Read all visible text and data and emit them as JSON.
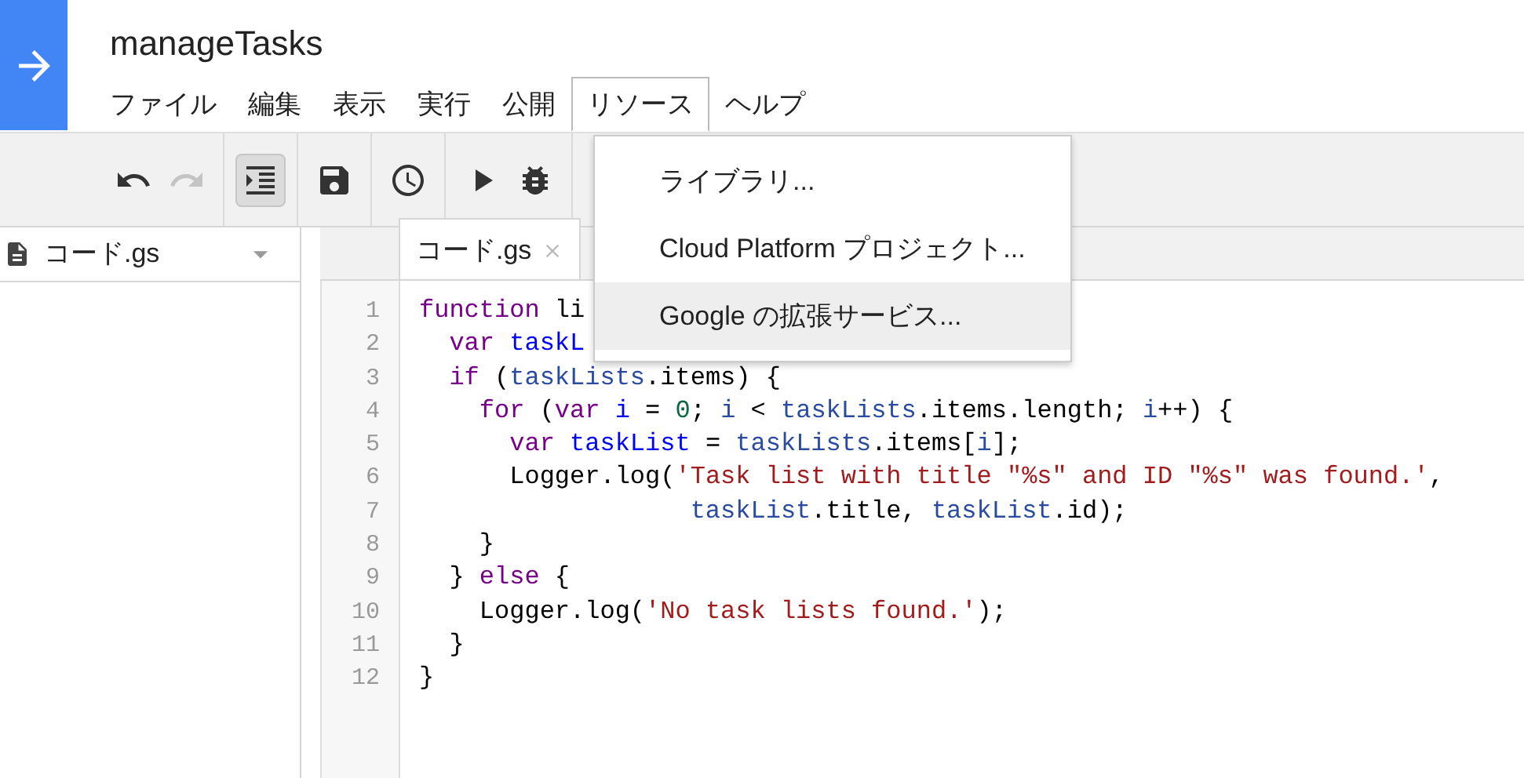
{
  "project": {
    "title": "manageTasks"
  },
  "menu": [
    {
      "label": "ファイル",
      "selected": false
    },
    {
      "label": "編集",
      "selected": false
    },
    {
      "label": "表示",
      "selected": false
    },
    {
      "label": "実行",
      "selected": false
    },
    {
      "label": "公開",
      "selected": false
    },
    {
      "label": "リソース",
      "selected": true
    },
    {
      "label": "ヘルプ",
      "selected": false
    }
  ],
  "toolbar": [
    {
      "kind": "undo",
      "disabled": false,
      "pressed": false
    },
    {
      "kind": "redo",
      "disabled": true,
      "pressed": false
    },
    {
      "kind": "indent",
      "disabled": false,
      "pressed": true
    },
    {
      "kind": "save",
      "disabled": false,
      "pressed": false
    },
    {
      "kind": "trigger",
      "disabled": false,
      "pressed": false
    },
    {
      "kind": "run",
      "disabled": false,
      "pressed": false
    },
    {
      "kind": "debug",
      "disabled": false,
      "pressed": false
    }
  ],
  "files": [
    {
      "name": "コード.gs"
    }
  ],
  "tabs": [
    {
      "label": "コード.gs",
      "selected": true
    }
  ],
  "dropdown": [
    {
      "label": "ライブラリ...",
      "highlighted": false
    },
    {
      "label": "Cloud Platform プロジェクト...",
      "highlighted": false
    },
    {
      "label": "Google の拡張サービス...",
      "highlighted": true
    }
  ],
  "code": [
    [
      {
        "text": "function",
        "kind": "keyword"
      },
      {
        "text": " li",
        "kind": "plain"
      }
    ],
    [
      {
        "text": "  var",
        "kind": "keyword"
      },
      {
        "text": " taskL",
        "kind": "def"
      }
    ],
    [
      {
        "text": "  if",
        "kind": "keyword"
      },
      {
        "text": " (",
        "kind": "plain"
      },
      {
        "text": "taskLists",
        "kind": "variable"
      },
      {
        "text": ".items) {",
        "kind": "plain"
      }
    ],
    [
      {
        "text": "    for",
        "kind": "keyword"
      },
      {
        "text": " (",
        "kind": "plain"
      },
      {
        "text": "var",
        "kind": "keyword"
      },
      {
        "text": " i",
        "kind": "def"
      },
      {
        "text": " = ",
        "kind": "plain"
      },
      {
        "text": "0",
        "kind": "number"
      },
      {
        "text": "; ",
        "kind": "plain"
      },
      {
        "text": "i",
        "kind": "variable"
      },
      {
        "text": " < ",
        "kind": "plain"
      },
      {
        "text": "taskLists",
        "kind": "variable"
      },
      {
        "text": ".items.length; ",
        "kind": "plain"
      },
      {
        "text": "i",
        "kind": "variable"
      },
      {
        "text": "++) {",
        "kind": "plain"
      }
    ],
    [
      {
        "text": "      var",
        "kind": "keyword"
      },
      {
        "text": " taskList",
        "kind": "def"
      },
      {
        "text": " = ",
        "kind": "plain"
      },
      {
        "text": "taskLists",
        "kind": "variable"
      },
      {
        "text": ".items[",
        "kind": "plain"
      },
      {
        "text": "i",
        "kind": "variable"
      },
      {
        "text": "];",
        "kind": "plain"
      }
    ],
    [
      {
        "text": "      Logger.log(",
        "kind": "plain"
      },
      {
        "text": "'Task list with title \"%s\" and ID \"%s\" was found.'",
        "kind": "string"
      },
      {
        "text": ",",
        "kind": "plain"
      }
    ],
    [
      {
        "text": "                  taskList",
        "kind": "variable"
      },
      {
        "text": ".title, ",
        "kind": "plain"
      },
      {
        "text": "taskList",
        "kind": "variable"
      },
      {
        "text": ".id);",
        "kind": "plain"
      }
    ],
    [
      {
        "text": "    }",
        "kind": "plain"
      }
    ],
    [
      {
        "text": "  } ",
        "kind": "plain"
      },
      {
        "text": "else",
        "kind": "keyword"
      },
      {
        "text": " {",
        "kind": "plain"
      }
    ],
    [
      {
        "text": "    Logger.log(",
        "kind": "plain"
      },
      {
        "text": "'No task lists found.'",
        "kind": "string"
      },
      {
        "text": ");",
        "kind": "plain"
      }
    ],
    [
      {
        "text": "  }",
        "kind": "plain"
      }
    ],
    [
      {
        "text": "}",
        "kind": "plain"
      }
    ]
  ],
  "line_numbers": [
    "1",
    "2",
    "3",
    "4",
    "5",
    "6",
    "7",
    "8",
    "9",
    "10",
    "11",
    "12"
  ]
}
